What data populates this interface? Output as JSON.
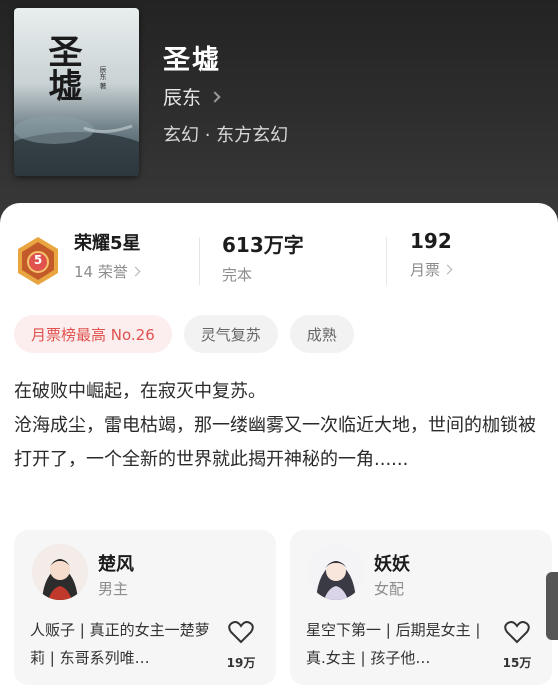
{
  "book": {
    "title": "圣墟",
    "author": "辰东",
    "genre": "玄幻 · 东方玄幻",
    "cover_text": "圣墟",
    "cover_author": "辰东 著"
  },
  "stats": {
    "honor_title": "荣耀5星",
    "honor_sub": "14 荣誉",
    "badge_number": "5",
    "words": "613万字",
    "status": "完本",
    "tickets": "192",
    "tickets_label": "月票"
  },
  "tags": [
    "月票榜最高 No.26",
    "灵气复苏",
    "成熟"
  ],
  "description": {
    "line1": "在破败中崛起，在寂灭中复苏。",
    "line2": "沧海成尘，雷电枯竭，那一缕幽雾又一次临近大地，世间的枷锁被打开了，一个全新的世界就此揭开神秘的一角......"
  },
  "characters": [
    {
      "name": "楚风",
      "role": "男主",
      "tags": "人贩子 | 真正的女主一楚萝莉 | 东哥系列唯…",
      "likes": "19万"
    },
    {
      "name": "妖妖",
      "role": "女配",
      "tags": "星空下第一 | 后期是女主 | 真.女主 | 孩子他…",
      "likes": "15万"
    }
  ],
  "colors": {
    "accent": "#e0524e",
    "badge": "#e07a2e"
  },
  "icons": {
    "heart": "heart-icon",
    "chevron": "chevron-right-icon"
  }
}
